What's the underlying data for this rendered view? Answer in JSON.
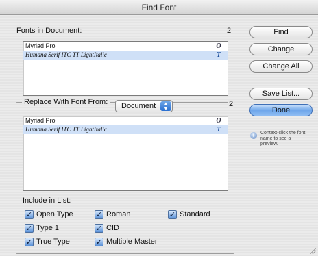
{
  "window": {
    "title": "Find Font"
  },
  "fonts_in_document": {
    "label": "Fonts in Document:",
    "count": "2",
    "items": [
      {
        "name": "Myriad Pro",
        "type_icon": "O"
      },
      {
        "name": "Humana Serif ITC TT LightItalic",
        "type_icon": "T"
      }
    ]
  },
  "replace_with": {
    "label": "Replace With Font From:",
    "source_value": "Document",
    "count": "2",
    "items": [
      {
        "name": "Myriad Pro",
        "type_icon": "O"
      },
      {
        "name": "Humana Serif ITC TT LightItalic",
        "type_icon": "T"
      }
    ]
  },
  "buttons": {
    "find": "Find",
    "change": "Change",
    "change_all": "Change All",
    "save_list": "Save List...",
    "done": "Done"
  },
  "hint": {
    "text": "Context-click the font name to see a preview."
  },
  "include_in_list": {
    "label": "Include in List:",
    "options": [
      {
        "label": "Open Type",
        "checked": true
      },
      {
        "label": "Roman",
        "checked": true
      },
      {
        "label": "Standard",
        "checked": true
      },
      {
        "label": "Type 1",
        "checked": true
      },
      {
        "label": "CID",
        "checked": true
      },
      {
        "label": "True Type",
        "checked": true
      },
      {
        "label": "Multiple Master",
        "checked": true
      }
    ]
  },
  "colors": {
    "accent": "#5a91d8",
    "selection": "#cfe0f7"
  }
}
